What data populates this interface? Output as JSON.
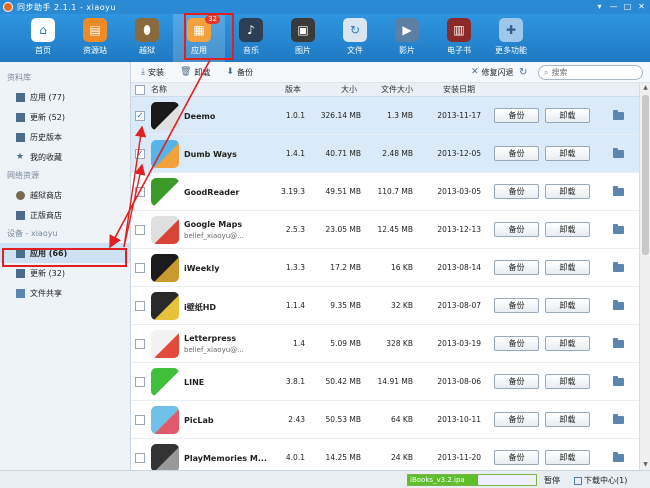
{
  "window": {
    "title": "同步助手 2.1.1 - xiaoyu"
  },
  "toolbar": {
    "items": [
      {
        "label": "首页",
        "color": "#ffffff",
        "icon": "home-icon"
      },
      {
        "label": "资源站",
        "color": "#f08a24",
        "icon": "store-icon"
      },
      {
        "label": "越狱",
        "color": "#8a6a3c",
        "icon": "jailbreak-icon"
      },
      {
        "label": "应用",
        "color": "#f2a13c",
        "icon": "apps-icon",
        "badge": "32"
      },
      {
        "label": "音乐",
        "color": "#2d3f54",
        "icon": "music-icon"
      },
      {
        "label": "图片",
        "color": "#3a3a3a",
        "icon": "photos-icon"
      },
      {
        "label": "文件",
        "color": "#d9e6f2",
        "icon": "files-icon"
      },
      {
        "label": "影片",
        "color": "#5c7fa3",
        "icon": "video-icon"
      },
      {
        "label": "电子书",
        "color": "#8c2a2a",
        "icon": "ebook-icon"
      },
      {
        "label": "更多功能",
        "color": "#9fc7ea",
        "icon": "more-icon"
      }
    ]
  },
  "sidebar": {
    "sections": [
      {
        "title": "资料库",
        "items": [
          {
            "label": "应用 (77)",
            "icon": "apps-grid-icon"
          },
          {
            "label": "更新 (52)",
            "icon": "update-icon"
          },
          {
            "label": "历史版本",
            "icon": "history-icon"
          },
          {
            "label": "我的收藏",
            "icon": "star-icon"
          }
        ]
      },
      {
        "title": "网络资源",
        "items": [
          {
            "label": "越狱商店",
            "icon": "jailbreak-store-icon"
          },
          {
            "label": "正版商店",
            "icon": "store-icon"
          }
        ]
      },
      {
        "title": "设备 - xiaoyu",
        "items": [
          {
            "label": "应用 (66)",
            "icon": "apps-grid-icon",
            "selected": true
          },
          {
            "label": "更新 (32)",
            "icon": "update-icon"
          },
          {
            "label": "文件共享",
            "icon": "folder-icon"
          }
        ]
      }
    ]
  },
  "actions": {
    "install": "安装",
    "uninstall": "卸载",
    "backup": "备份",
    "repair": "修复闪退",
    "search_placeholder": "搜索"
  },
  "table": {
    "headers": {
      "name": "名称",
      "version": "版本",
      "size": "大小",
      "file_size": "文件大小",
      "install_date": "安装日期"
    },
    "backup_label": "备份",
    "uninstall_label": "卸载",
    "rows": [
      {
        "name": "Deemo",
        "sub": "",
        "version": "1.0.1",
        "size": "326.14 MB",
        "file_size": "1.3 MB",
        "date": "2013-11-17",
        "checked": true,
        "selected": true,
        "icon_color": "#1a1a1a",
        "icon_accent": "#e0e0e0"
      },
      {
        "name": "Dumb Ways",
        "sub": "",
        "version": "1.4.1",
        "size": "40.71 MB",
        "file_size": "2.48 MB",
        "date": "2013-12-05",
        "checked": true,
        "selected": true,
        "icon_color": "#57b4e8",
        "icon_accent": "#f3a23b"
      },
      {
        "name": "GoodReader",
        "sub": "",
        "version": "3.19.3",
        "size": "49.51 MB",
        "file_size": "110.7 MB",
        "date": "2013-03-05",
        "checked": false,
        "selected": false,
        "icon_color": "#3c9a2a",
        "icon_accent": "#ffffff"
      },
      {
        "name": "Google Maps",
        "sub": "belief_xiaoyu@...",
        "version": "2.5.3",
        "size": "23.05 MB",
        "file_size": "12.45 MB",
        "date": "2013-12-13",
        "checked": false,
        "selected": false,
        "icon_color": "#e0e0e0",
        "icon_accent": "#d94436"
      },
      {
        "name": "iWeekly",
        "sub": "",
        "version": "1.3.3",
        "size": "17.2 MB",
        "file_size": "16 KB",
        "date": "2013-08-14",
        "checked": false,
        "selected": false,
        "icon_color": "#1b1b1b",
        "icon_accent": "#c99a2e"
      },
      {
        "name": "i壁纸HD",
        "sub": "",
        "version": "1.1.4",
        "size": "9.35 MB",
        "file_size": "32 KB",
        "date": "2013-08-07",
        "checked": false,
        "selected": false,
        "icon_color": "#2a2a2a",
        "icon_accent": "#e7c33a"
      },
      {
        "name": "Letterpress",
        "sub": "belief_xiaoyu@...",
        "version": "1.4",
        "size": "5.09 MB",
        "file_size": "328 KB",
        "date": "2013-03-19",
        "checked": false,
        "selected": false,
        "icon_color": "#f2f2f2",
        "icon_accent": "#e24a3b"
      },
      {
        "name": "LINE",
        "sub": "",
        "version": "3.8.1",
        "size": "50.42 MB",
        "file_size": "14.91 MB",
        "date": "2013-08-06",
        "checked": false,
        "selected": false,
        "icon_color": "#3fbf3a",
        "icon_accent": "#ffffff"
      },
      {
        "name": "PicLab",
        "sub": "",
        "version": "2.43",
        "size": "50.53 MB",
        "file_size": "64 KB",
        "date": "2013-10-11",
        "checked": false,
        "selected": false,
        "icon_color": "#6fc1e8",
        "icon_accent": "#e05a6b"
      },
      {
        "name": "PlayMemories M...",
        "sub": "",
        "version": "4.0.1",
        "size": "14.25 MB",
        "file_size": "24 KB",
        "date": "2013-11-20",
        "checked": false,
        "selected": false,
        "icon_color": "#333333",
        "icon_accent": "#999999"
      }
    ]
  },
  "status": {
    "download_file": "iBooks_v3.2.ipa",
    "progress": 0.55,
    "pause": "暂停",
    "download_center": "下载中心(1)"
  }
}
